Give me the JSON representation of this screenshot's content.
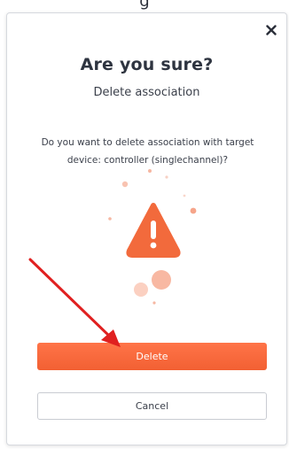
{
  "background_header": {
    "partial_text": "g"
  },
  "dialog": {
    "title": "Are you sure?",
    "subtitle": "Delete association",
    "message": "Do you want to delete association with target device: controller (singlechannel)?",
    "close_icon": "close-icon",
    "illustration_icon": "warning-triangle-icon",
    "primary_button_label": "Delete",
    "secondary_button_label": "Cancel"
  },
  "colors": {
    "accent": "#f26a3c",
    "annotation_arrow": "#e02020",
    "text_dark": "#2e3440"
  }
}
